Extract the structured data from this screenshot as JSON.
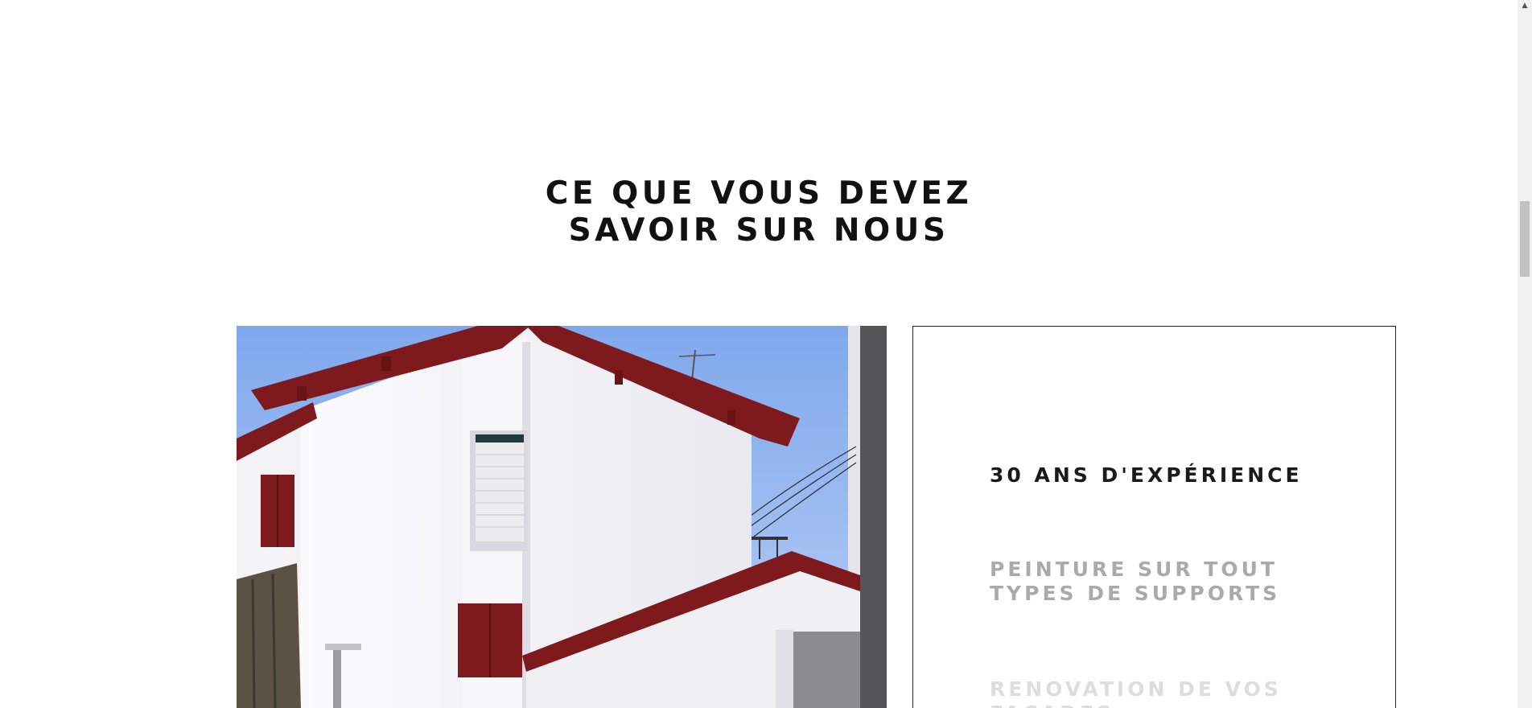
{
  "section": {
    "title_line1": "CE QUE VOUS DEVEZ",
    "title_line2": "SAVOIR SUR NOUS"
  },
  "features": [
    {
      "line1": "30 ANS D'EXPÉRIENCE",
      "line2": ""
    },
    {
      "line1": "PEINTURE SUR TOUT",
      "line2": "TYPES DE SUPPORTS"
    },
    {
      "line1": "RENOVATION DE VOS",
      "line2": "FACADES"
    }
  ],
  "colors": {
    "roof_red": "#7e1a1d",
    "sky_blue": "#8fb5ef",
    "wall_white": "#f2f2f5"
  },
  "scrollbar": {
    "arrow_icon": "triangle-up-icon"
  }
}
